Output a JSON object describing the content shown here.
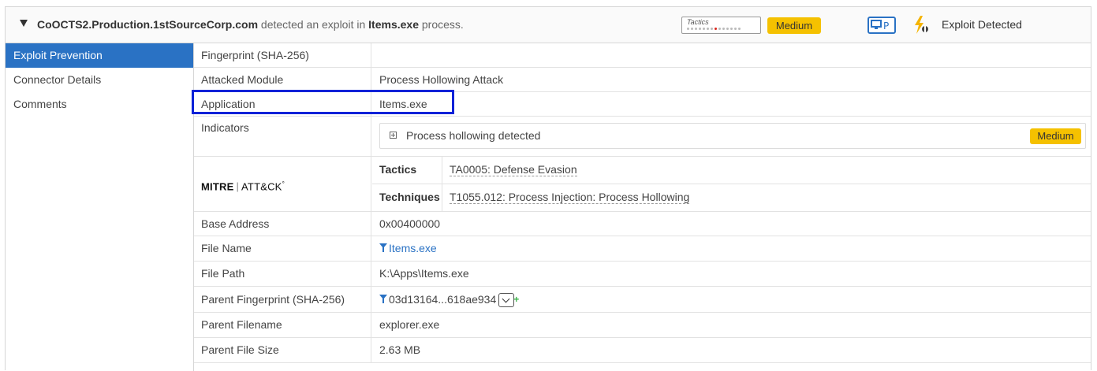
{
  "header": {
    "host": "CoOCTS2.Production.1stSourceCorp.com",
    "middle_text": " detected an exploit in ",
    "process": "Items.exe",
    "suffix_text": " process.",
    "tactics_label": "Tactics",
    "severity": "Medium",
    "event_type": "Exploit Detected"
  },
  "nav": {
    "items": [
      {
        "label": "Exploit Prevention",
        "active": true
      },
      {
        "label": "Connector Details",
        "active": false
      },
      {
        "label": "Comments",
        "active": false
      }
    ]
  },
  "details": {
    "fingerprint": {
      "key": "Fingerprint (SHA-256)",
      "value": ""
    },
    "attacked_module": {
      "key": "Attacked Module",
      "value": "Process Hollowing Attack"
    },
    "application": {
      "key": "Application",
      "value": "Items.exe"
    },
    "indicators": {
      "key": "Indicators",
      "text": "Process hollowing detected",
      "severity": "Medium"
    },
    "mitre": {
      "logo_left": "MITRE",
      "logo_sep": "|",
      "logo_right": "ATT&CK",
      "logo_mark": "°",
      "tactics_key": "Tactics",
      "tactics_value": "TA0005: Defense Evasion",
      "techniques_key": "Techniques",
      "techniques_value": "T1055.012: Process Injection: Process Hollowing"
    },
    "base_address": {
      "key": "Base Address",
      "value": "0x00400000"
    },
    "file_name": {
      "key": "File Name",
      "value": "Items.exe"
    },
    "file_path": {
      "key": "File Path",
      "value": "K:\\Apps\\Items.exe"
    },
    "parent_fingerprint": {
      "key": "Parent Fingerprint (SHA-256)",
      "value": "03d13164...618ae934"
    },
    "parent_filename": {
      "key": "Parent Filename",
      "value": "explorer.exe"
    },
    "parent_file_size": {
      "key": "Parent File Size",
      "value": "2.63 MB"
    }
  },
  "colors": {
    "accent": "#2a72c4",
    "badge": "#f5c100",
    "highlight": "#0a22d8"
  }
}
